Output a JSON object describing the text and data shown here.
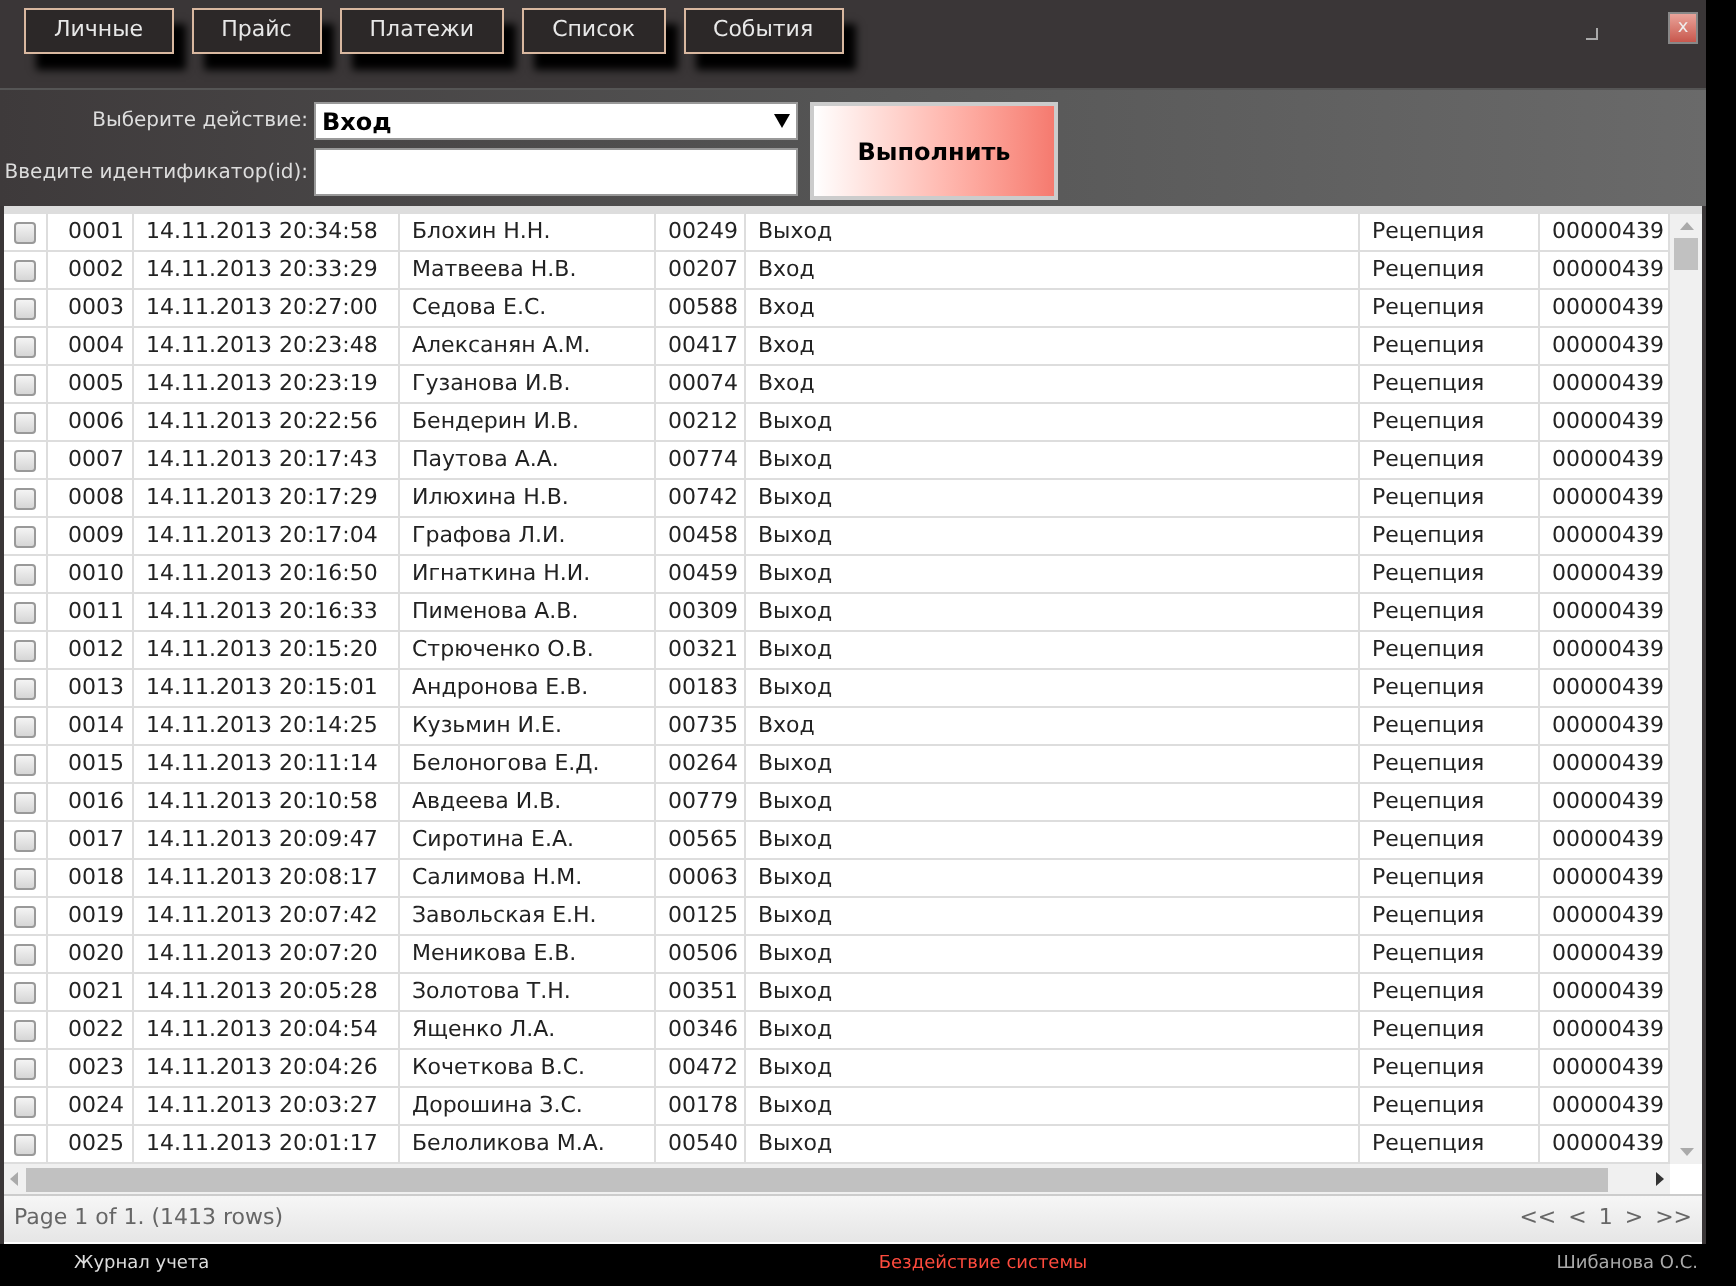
{
  "tabs": [
    "Личные",
    "Прайс",
    "Платежи",
    "Список",
    "События"
  ],
  "window": {
    "close": "x"
  },
  "form": {
    "action_label": "Выберите действие:",
    "action_value": "Вход",
    "id_label": "Введите идентификатор(id):",
    "submit": "Выполнить"
  },
  "table": {
    "rows": [
      {
        "checked": false,
        "cells": [
          "0001",
          "14.11.2013 20:34:58",
          "Блохин Н.Н.",
          "00249",
          "Выход",
          "Рецепция",
          "00000439"
        ]
      },
      {
        "checked": false,
        "cells": [
          "0002",
          "14.11.2013 20:33:29",
          "Матвеева Н.В.",
          "00207",
          "Вход",
          "Рецепция",
          "00000439"
        ]
      },
      {
        "checked": false,
        "cells": [
          "0003",
          "14.11.2013 20:27:00",
          "Седова Е.С.",
          "00588",
          "Вход",
          "Рецепция",
          "00000439"
        ]
      },
      {
        "checked": false,
        "cells": [
          "0004",
          "14.11.2013 20:23:48",
          "Алексанян А.М.",
          "00417",
          "Вход",
          "Рецепция",
          "00000439"
        ]
      },
      {
        "checked": false,
        "cells": [
          "0005",
          "14.11.2013 20:23:19",
          "Гузанова И.В.",
          "00074",
          "Вход",
          "Рецепция",
          "00000439"
        ]
      },
      {
        "checked": false,
        "cells": [
          "0006",
          "14.11.2013 20:22:56",
          "Бендерин И.В.",
          "00212",
          "Выход",
          "Рецепция",
          "00000439"
        ]
      },
      {
        "checked": false,
        "cells": [
          "0007",
          "14.11.2013 20:17:43",
          "Паутова А.А.",
          "00774",
          "Выход",
          "Рецепция",
          "00000439"
        ]
      },
      {
        "checked": false,
        "cells": [
          "0008",
          "14.11.2013 20:17:29",
          "Илюхина Н.В.",
          "00742",
          "Выход",
          "Рецепция",
          "00000439"
        ]
      },
      {
        "checked": false,
        "cells": [
          "0009",
          "14.11.2013 20:17:04",
          "Графова Л.И.",
          "00458",
          "Выход",
          "Рецепция",
          "00000439"
        ]
      },
      {
        "checked": false,
        "cells": [
          "0010",
          "14.11.2013 20:16:50",
          "Игнаткина Н.И.",
          "00459",
          "Выход",
          "Рецепция",
          "00000439"
        ]
      },
      {
        "checked": false,
        "cells": [
          "0011",
          "14.11.2013 20:16:33",
          "Пименова А.В.",
          "00309",
          "Выход",
          "Рецепция",
          "00000439"
        ]
      },
      {
        "checked": false,
        "cells": [
          "0012",
          "14.11.2013 20:15:20",
          "Стрюченко О.В.",
          "00321",
          "Выход",
          "Рецепция",
          "00000439"
        ]
      },
      {
        "checked": false,
        "cells": [
          "0013",
          "14.11.2013 20:15:01",
          "Андронова Е.В.",
          "00183",
          "Выход",
          "Рецепция",
          "00000439"
        ]
      },
      {
        "checked": false,
        "cells": [
          "0014",
          "14.11.2013 20:14:25",
          "Кузьмин И.Е.",
          "00735",
          "Вход",
          "Рецепция",
          "00000439"
        ]
      },
      {
        "checked": false,
        "cells": [
          "0015",
          "14.11.2013 20:11:14",
          "Белоногова Е.Д.",
          "00264",
          "Выход",
          "Рецепция",
          "00000439"
        ]
      },
      {
        "checked": false,
        "cells": [
          "0016",
          "14.11.2013 20:10:58",
          "Авдеева И.В.",
          "00779",
          "Выход",
          "Рецепция",
          "00000439"
        ]
      },
      {
        "checked": false,
        "cells": [
          "0017",
          "14.11.2013 20:09:47",
          "Сиротина Е.А.",
          "00565",
          "Выход",
          "Рецепция",
          "00000439"
        ]
      },
      {
        "checked": false,
        "cells": [
          "0018",
          "14.11.2013 20:08:17",
          "Салимова Н.М.",
          "00063",
          "Выход",
          "Рецепция",
          "00000439"
        ]
      },
      {
        "checked": false,
        "cells": [
          "0019",
          "14.11.2013 20:07:42",
          "Завольская Е.Н.",
          "00125",
          "Выход",
          "Рецепция",
          "00000439"
        ]
      },
      {
        "checked": false,
        "cells": [
          "0020",
          "14.11.2013 20:07:20",
          "Меникова Е.В.",
          "00506",
          "Выход",
          "Рецепция",
          "00000439"
        ]
      },
      {
        "checked": false,
        "cells": [
          "0021",
          "14.11.2013 20:05:28",
          "Золотова Т.Н.",
          "00351",
          "Выход",
          "Рецепция",
          "00000439"
        ]
      },
      {
        "checked": false,
        "cells": [
          "0022",
          "14.11.2013 20:04:54",
          "Ященко Л.А.",
          "00346",
          "Выход",
          "Рецепция",
          "00000439"
        ]
      },
      {
        "checked": false,
        "cells": [
          "0023",
          "14.11.2013 20:04:26",
          "Кочеткова В.С.",
          "00472",
          "Выход",
          "Рецепция",
          "00000439"
        ]
      },
      {
        "checked": false,
        "cells": [
          "0024",
          "14.11.2013 20:03:27",
          "Дорошина З.С.",
          "00178",
          "Выход",
          "Рецепция",
          "00000439"
        ]
      },
      {
        "checked": false,
        "cells": [
          "0025",
          "14.11.2013 20:01:17",
          "Белоликова М.А.",
          "00540",
          "Выход",
          "Рецепция",
          "00000439"
        ]
      }
    ]
  },
  "pager": {
    "info": "Page 1 of 1. (1413 rows)",
    "first": "<<",
    "prev": "<",
    "page": "1",
    "next": ">",
    "last": ">>"
  },
  "status_bar": {
    "left": "Журнал учета",
    "center": "Бездействие системы",
    "right": "Шибанова О.С."
  }
}
